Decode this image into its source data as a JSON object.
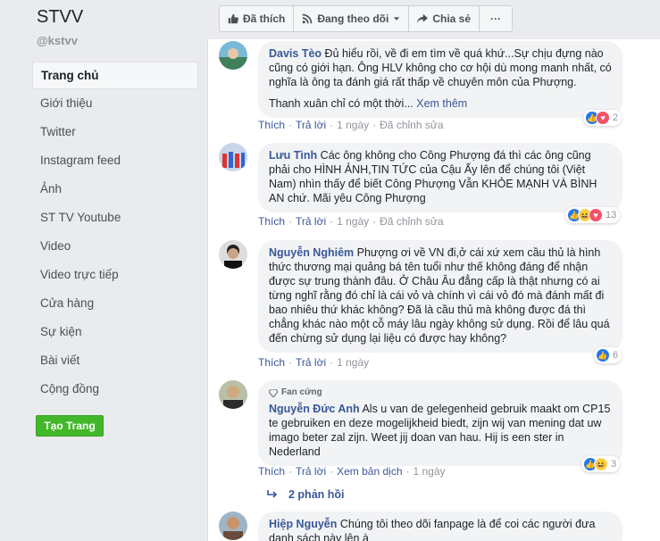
{
  "page": {
    "name": "STVV",
    "handle": "@kstvv"
  },
  "nav": [
    {
      "label": "Trang chủ",
      "active": true
    },
    {
      "label": "Giới thiệu"
    },
    {
      "label": "Twitter"
    },
    {
      "label": "Instagram feed"
    },
    {
      "label": "Ảnh"
    },
    {
      "label": "ST TV Youtube"
    },
    {
      "label": "Video"
    },
    {
      "label": "Video trực tiếp"
    },
    {
      "label": "Cửa hàng"
    },
    {
      "label": "Sự kiện"
    },
    {
      "label": "Bài viết"
    },
    {
      "label": "Cộng đồng"
    }
  ],
  "create_page_label": "Tạo Trang",
  "actions": {
    "liked": "Đã thích",
    "following": "Đang theo dõi",
    "share": "Chia sẻ",
    "more": "···"
  },
  "comments": [
    {
      "author": "Davis Tèo",
      "text": "Đủ hiểu rồi, về đi em tìm về quá khứ...Sự chịu đựng nào cũng có giới hạn. Ông HLV không cho cơ hội dù mong manh nhất, có nghĩa là ông ta đánh giá rất thấp về chuyên môn của Phượng.",
      "text2": "Thanh xuân chỉ có một thời... ",
      "see_more": "Xem thêm",
      "like": "Thích",
      "reply": "Trả lời",
      "time": "1 ngày",
      "edited": "Đã chỉnh sửa",
      "reaction_count": "2"
    },
    {
      "author": "Lưu Tình",
      "text": "Các ông không cho Công Phượng đá thì các ông cũng phải cho HÌNH ẢNH,TIN TỨC của Cậu Ấy lên để chúng tôi (Việt Nam) nhìn thấy để biết Công Phượng Vẫn KHỎE MẠNH VÀ BÌNH AN chứ. Mãi yêu Công Phượng",
      "like": "Thích",
      "reply": "Trả lời",
      "time": "1 ngày",
      "edited": "Đã chỉnh sửa",
      "reaction_count": "13"
    },
    {
      "author": "Nguyễn Nghiêm",
      "text": "Phượng ơi về VN đi,ở cái xứ xem cầu thủ là hình thức thương mại quảng bá tên tuổi như thế không đáng để nhận được sự trung thành đâu. Ở Châu Âu đẳng cấp là thật nhưng có ai từng nghĩ rằng đó chỉ là cái vỏ và chính vì cái vỏ đó mà đánh mất đi bao nhiêu thứ khác không? Đã là cầu thủ mà không được đá thì chẳng khác nào một cỗ máy lâu ngày không sử dụng. Rồi để lâu quá đến chừng sử dụng lại liệu có được hay không?",
      "like": "Thích",
      "reply": "Trả lời",
      "time": "1 ngày",
      "reaction_count": "6"
    },
    {
      "badge": "Fan cứng",
      "author": "Nguyễn Đức Anh",
      "text": "Als u van de gelegenheid gebruik maakt om CP15 te gebruiken en deze mogelijkheid biedt, zijn wij van mening dat uw imago beter zal zijn. Weet jij doan van hau. Hij is een ster in Nederland",
      "like": "Thích",
      "reply": "Trả lời",
      "translate": "Xem bản dịch",
      "time": "1 ngày",
      "reaction_count": "3",
      "replies": "2 phản hồi"
    },
    {
      "author": "Hiệp Nguyễn",
      "text": "Chúng tôi theo dõi fanpage là để coi các người đưa danh sách này lên à"
    }
  ]
}
